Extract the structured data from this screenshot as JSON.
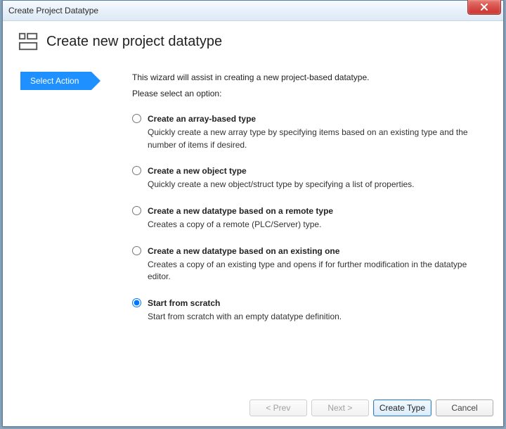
{
  "window": {
    "title": "Create Project Datatype"
  },
  "header": {
    "title": "Create new project datatype"
  },
  "wizard": {
    "step_label": "Select Action",
    "intro": "This wizard will assist in creating a new project-based datatype.",
    "prompt": "Please select an option:",
    "options": [
      {
        "id": "array",
        "title": "Create an array-based type",
        "desc": "Quickly create a new array type by specifying items based on an existing type and the number of items if desired.",
        "selected": false
      },
      {
        "id": "object",
        "title": "Create a new object type",
        "desc": "Quickly create a new object/struct type by specifying a list of properties.",
        "selected": false
      },
      {
        "id": "remote",
        "title": "Create a new datatype based on a remote type",
        "desc": "Creates a copy of a remote (PLC/Server) type.",
        "selected": false
      },
      {
        "id": "existing",
        "title": "Create a new datatype based on an existing one",
        "desc": "Creates a copy of an existing type and opens if for further modification in the datatype editor.",
        "selected": false
      },
      {
        "id": "scratch",
        "title": "Start from scratch",
        "desc": "Start from scratch with an empty datatype definition.",
        "selected": true
      }
    ]
  },
  "buttons": {
    "prev": "< Prev",
    "next": "Next >",
    "create": "Create Type",
    "cancel": "Cancel",
    "prev_enabled": false,
    "next_enabled": false
  }
}
